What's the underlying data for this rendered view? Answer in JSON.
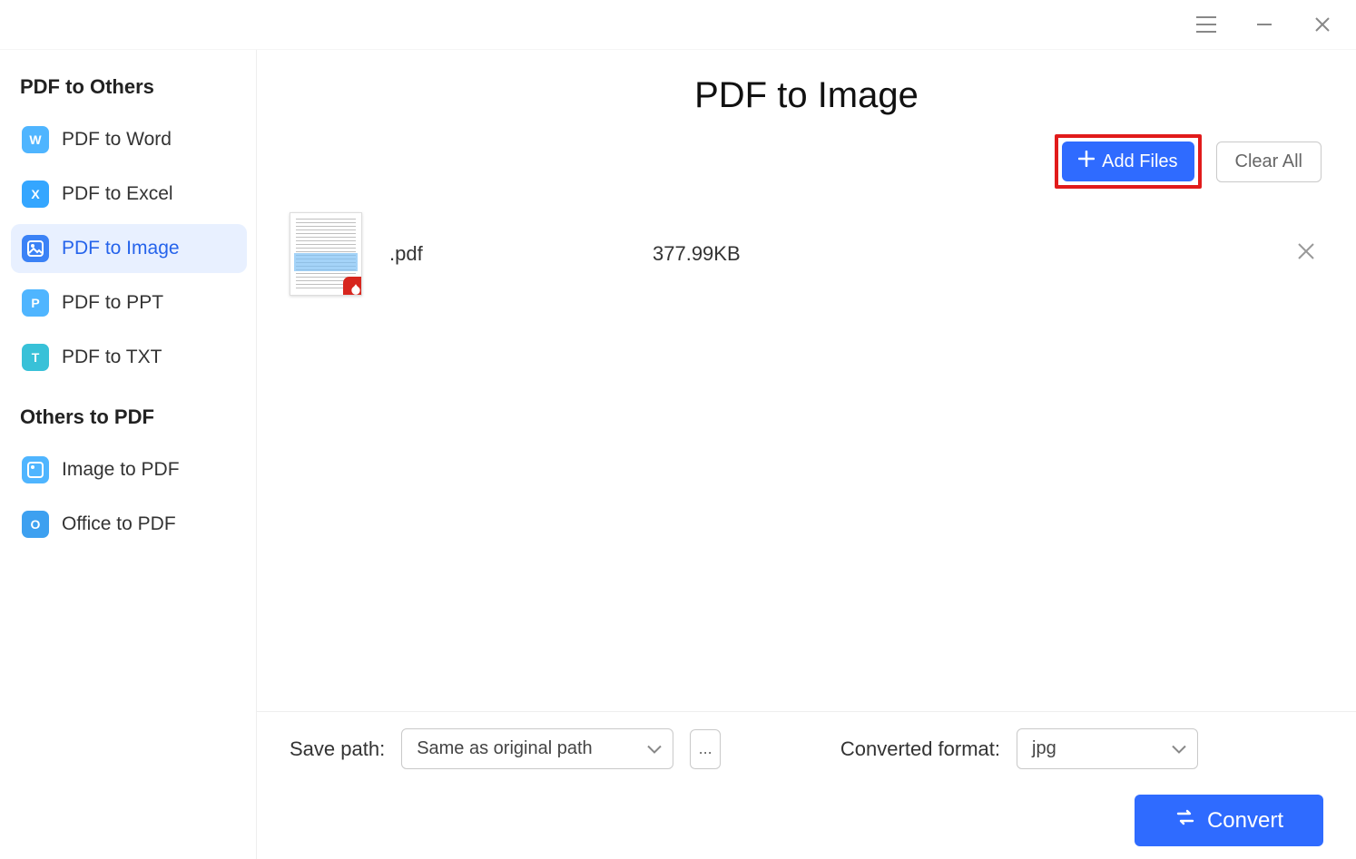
{
  "window": {
    "menu": "≡",
    "min": "—",
    "close": "×"
  },
  "sidebar": {
    "section1_title": "PDF to Others",
    "section2_title": "Others to PDF",
    "items1": [
      {
        "label": "PDF to Word",
        "icon": "W"
      },
      {
        "label": "PDF to Excel",
        "icon": "X"
      },
      {
        "label": "PDF to Image",
        "icon": "▢"
      },
      {
        "label": "PDF to PPT",
        "icon": "P"
      },
      {
        "label": "PDF to TXT",
        "icon": "T"
      }
    ],
    "items2": [
      {
        "label": "Image to PDF",
        "icon": "▢"
      },
      {
        "label": "Office to PDF",
        "icon": "O"
      }
    ]
  },
  "main": {
    "title": "PDF to Image",
    "add_files": "Add Files",
    "clear_all": "Clear All"
  },
  "files": [
    {
      "name": ".pdf",
      "size": "377.99KB"
    }
  ],
  "bottom": {
    "save_label": "Save path:",
    "save_value": "Same as original path",
    "browse": "...",
    "format_label": "Converted format:",
    "format_value": "jpg",
    "convert": "Convert"
  }
}
